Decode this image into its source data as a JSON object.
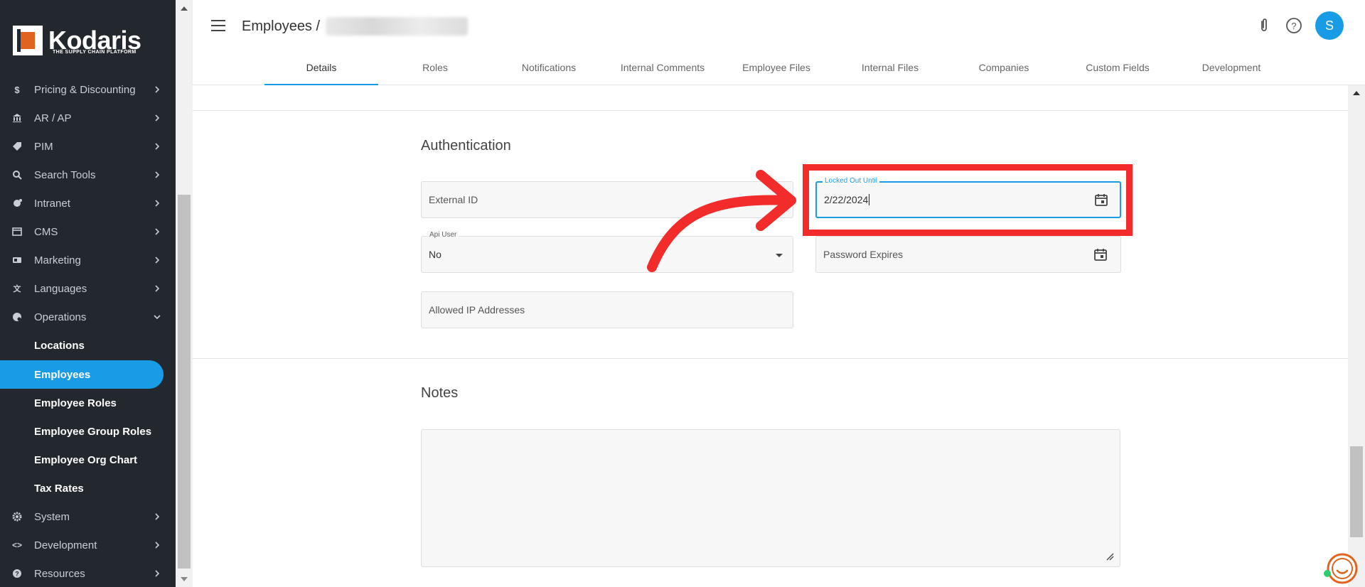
{
  "brand": {
    "name": "Kodaris",
    "tagline": "THE SUPPLY CHAIN PLATFORM",
    "accent_color": "#e0641f"
  },
  "sidebar": {
    "items": [
      {
        "label": "Pricing & Discounting",
        "icon": "dollar-icon"
      },
      {
        "label": "AR / AP",
        "icon": "bank-icon"
      },
      {
        "label": "PIM",
        "icon": "tag-icon"
      },
      {
        "label": "Search Tools",
        "icon": "search-icon"
      },
      {
        "label": "Intranet",
        "icon": "hub-icon"
      },
      {
        "label": "CMS",
        "icon": "cms-icon"
      },
      {
        "label": "Marketing",
        "icon": "megaphone-icon"
      },
      {
        "label": "Languages",
        "icon": "translate-icon"
      },
      {
        "label": "Operations",
        "icon": "operations-icon"
      }
    ],
    "sub_items": [
      {
        "label": "Locations"
      },
      {
        "label": "Employees"
      },
      {
        "label": "Employee Roles"
      },
      {
        "label": "Employee Group Roles"
      },
      {
        "label": "Employee Org Chart"
      },
      {
        "label": "Tax Rates"
      }
    ],
    "bottom_items": [
      {
        "label": "System",
        "icon": "gear-icon"
      },
      {
        "label": "Development",
        "icon": "code-icon"
      },
      {
        "label": "Resources",
        "icon": "help-circle-icon"
      }
    ],
    "active_color": "#1a9be6"
  },
  "header": {
    "breadcrumb_root": "Employees /",
    "avatar_initial": "S"
  },
  "tabs": [
    "Details",
    "Roles",
    "Notifications",
    "Internal Comments",
    "Employee Files",
    "Internal Files",
    "Companies",
    "Custom Fields",
    "Development"
  ],
  "authentication": {
    "title": "Authentication",
    "external_id_placeholder": "External ID",
    "locked_out_label": "Locked Out Until",
    "locked_out_value": "2/22/2024",
    "api_user_label": "Api User",
    "api_user_value": "No",
    "password_expires_placeholder": "Password Expires",
    "allowed_ip_placeholder": "Allowed IP Addresses"
  },
  "notes": {
    "title": "Notes"
  },
  "annotation_color": "#f22b2b"
}
